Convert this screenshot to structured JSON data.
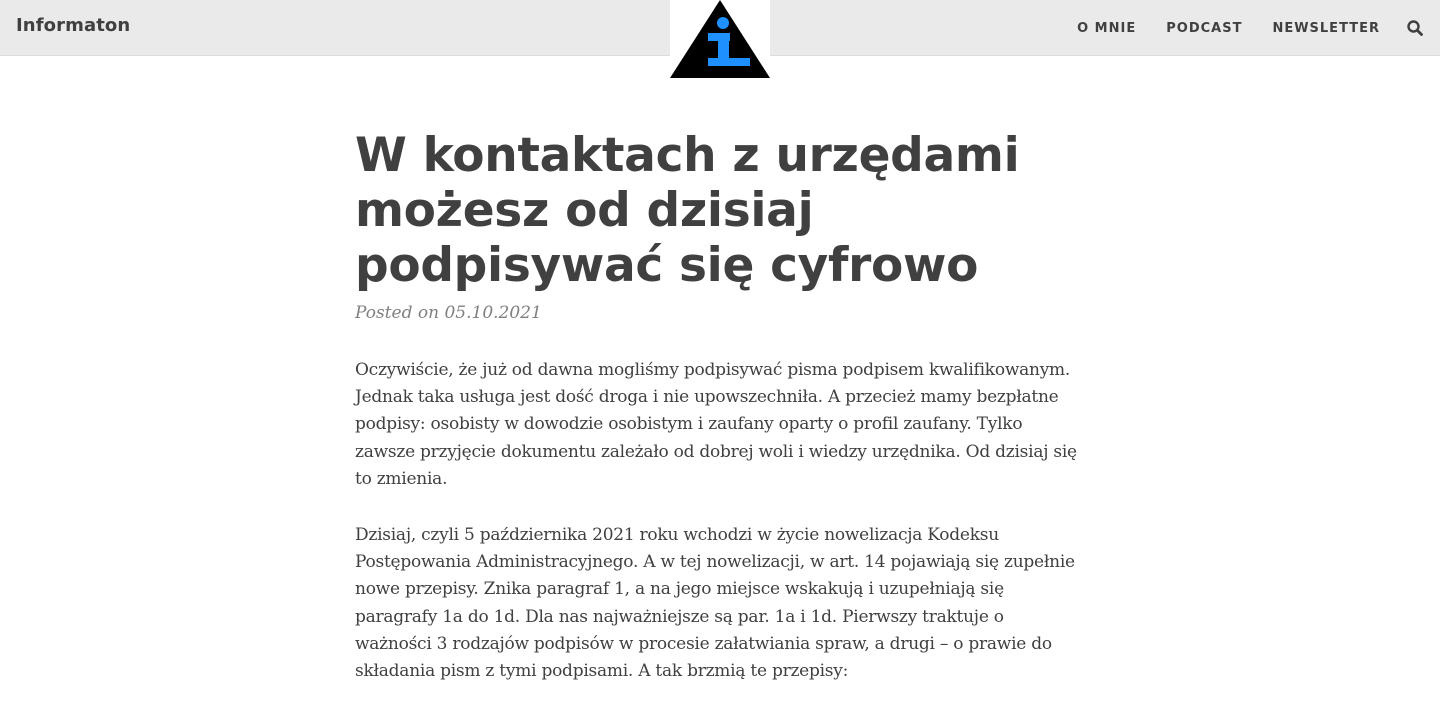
{
  "header": {
    "brand": "Informaton",
    "nav": [
      "O MNIE",
      "PODCAST",
      "NEWSLETTER"
    ],
    "search_icon": "search-icon",
    "logo_icon": "info-triangle-logo",
    "colors": {
      "navbar_bg": "#eaeaea",
      "logo_triangle": "#000000",
      "logo_letter": "#1e90ff"
    }
  },
  "post": {
    "title": "W kontaktach z urzędami możesz od dzisiaj podpisywać się cyfrowo",
    "meta": "Posted on 05.10.2021",
    "paragraphs": [
      "Oczywiście, że już od dawna mogliśmy podpisywać pisma podpisem kwalifikowanym. Jednak taka usługa jest dość droga i nie upowszechniła. A przecież mamy bezpłatne podpisy: osobisty w dowodzie osobistym i zaufany oparty o profil zaufany. Tylko zawsze przyjęcie dokumentu zależało od dobrej woli i wiedzy urzędnika. Od dzisiaj się to zmienia.",
      "Dzisiaj, czyli 5 października 2021 roku wchodzi w życie nowelizacja Kodeksu Postępowania Administracyjnego. A w tej nowelizacji, w art. 14 pojawiają się zupełnie nowe przepisy. Znika paragraf 1, a na jego miejsce wskakują i uzupełniają się paragrafy 1a do 1d. Dla nas najważniejsze są par. 1a i 1d. Pierwszy traktuje o ważności 3 rodzajów podpisów w procesie załatwiania spraw, a drugi – o prawie do składania pism z tymi podpisami. A tak brzmią te przepisy:"
    ]
  }
}
